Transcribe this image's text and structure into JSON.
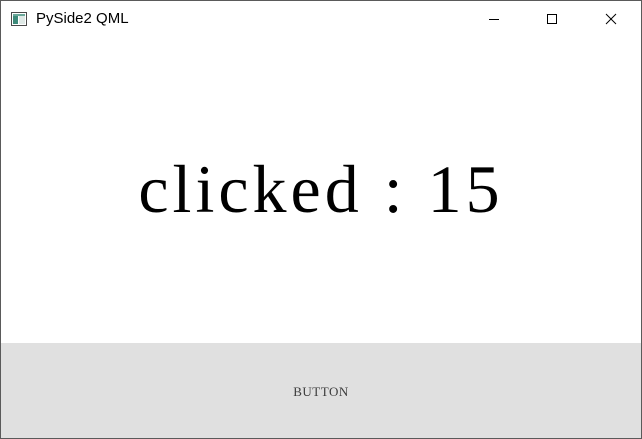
{
  "window": {
    "title": "PySide2 QML",
    "icon": "qt-window-icon",
    "controls": {
      "minimize_icon": "minimize-icon",
      "maximize_icon": "maximize-icon",
      "close_icon": "close-icon"
    }
  },
  "main": {
    "counter_text": "clicked : 15"
  },
  "button": {
    "label": "BUTTON",
    "background_color": "#e0e0e0"
  }
}
